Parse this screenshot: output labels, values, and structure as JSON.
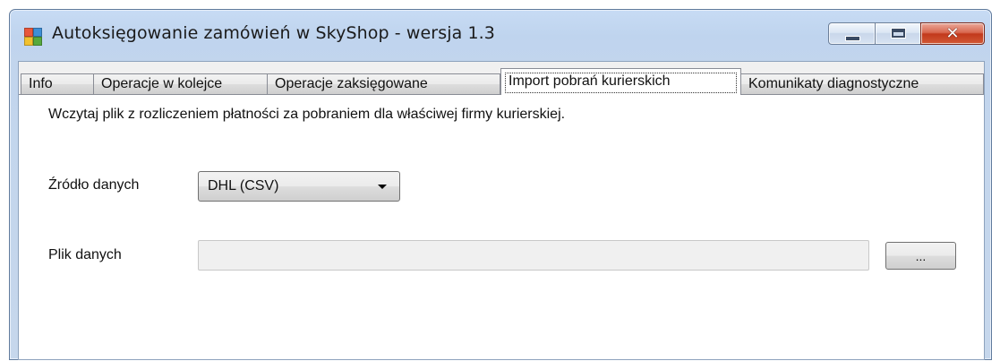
{
  "window": {
    "title": "Autoksięgowanie zamówień w SkyShop - wersja 1.3",
    "icon": "app-window-icon",
    "controls": {
      "minimize_icon": "minimize-icon",
      "maximize_icon": "maximize-icon",
      "close_glyph": "✕"
    }
  },
  "tabs": [
    {
      "label": "Info",
      "active": false
    },
    {
      "label": "Operacje w kolejce",
      "active": false
    },
    {
      "label": "Operacje zaksięgowane",
      "active": false
    },
    {
      "label": "Import pobrań kurierskich",
      "active": true
    },
    {
      "label": "Komunikaty diagnostyczne",
      "active": false
    }
  ],
  "import_panel": {
    "description": "Wczytaj plik z rozliczeniem płatności za pobraniem dla właściwej firmy kurierskiej.",
    "source_label": "Źródło danych",
    "source_value": "DHL (CSV)",
    "file_label": "Plik danych",
    "file_value": "",
    "browse_label": "..."
  },
  "colors": {
    "title_bar": "#c2d5ed",
    "panel_bg": "#ffffff",
    "close_button": "#c2391c"
  }
}
